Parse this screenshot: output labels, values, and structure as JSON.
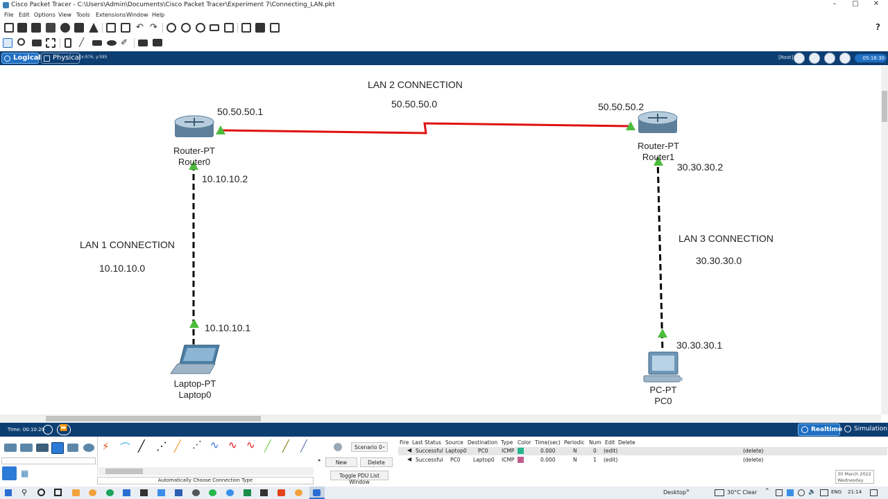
{
  "window": {
    "title": "Cisco Packet Tracer - C:\\Users\\Admin\\Documents\\Cisco Packet Tracer\\Experiment 7\\Connecting_LAN.pkt",
    "help": "?"
  },
  "menu": [
    "File",
    "Edit",
    "Options",
    "View",
    "Tools",
    "Extensions",
    "Window",
    "Help"
  ],
  "modebar": {
    "logical": "Logical",
    "physical": "Physical",
    "coords": "x:976, y:595",
    "root": "[Root]",
    "clock": "05:16:30"
  },
  "workspace": {
    "lan_labels": {
      "lan2_title": "LAN 2 CONNECTION",
      "lan2_net": "50.50.50.0",
      "lan1_title": "LAN 1 CONNECTION",
      "lan1_net": "10.10.10.0",
      "lan3_title": "LAN 3 CONNECTION",
      "lan3_net": "30.30.30.0"
    },
    "ip_labels": {
      "r0_serial": "50.50.50.1",
      "r1_serial": "50.50.50.2",
      "r0_fa": "10.10.10.2",
      "r1_fa": "30.30.30.2",
      "laptop": "10.10.10.1",
      "pc": "30.30.30.1"
    },
    "devices": {
      "router0": {
        "type": "Router-PT",
        "name": "Router0"
      },
      "router1": {
        "type": "Router-PT",
        "name": "Router1"
      },
      "laptop0": {
        "type": "Laptop-PT",
        "name": "Laptop0"
      },
      "pc0": {
        "type": "PC-PT",
        "name": "PC0"
      }
    },
    "colors": {
      "serial_link": "#e01010",
      "ethernet_link": "#000000",
      "link_up": "#4cbb3c"
    }
  },
  "timebar": {
    "time": "Time: 00:10:20",
    "realtime": "Realtime",
    "simulation": "Simulation"
  },
  "bottom": {
    "connection_hint": "Automatically Choose Connection Type",
    "scenario": "Scenario 0",
    "new": "New",
    "delete": "Delete",
    "toggle": "Toggle PDU List Window",
    "pdu_headers": [
      "Fire",
      "Last Status",
      "Source",
      "Destination",
      "Type",
      "Color",
      "Time(sec)",
      "Periodic",
      "Num",
      "Edit",
      "Delete"
    ],
    "pdu_rows": [
      {
        "status": "Successful",
        "source": "Laptop0",
        "destination": "PC0",
        "type": "ICMP",
        "color": "#28b48c",
        "time": "0.000",
        "periodic": "N",
        "num": "0",
        "edit": "(edit)",
        "delete": "(delete)"
      },
      {
        "status": "Successful",
        "source": "PC0",
        "destination": "Laptop0",
        "type": "ICMP",
        "color": "#c25d8e",
        "time": "0.000",
        "periodic": "N",
        "num": "1",
        "edit": "(edit)",
        "delete": "(delete)"
      }
    ],
    "tooltip_date": "30 March 2022",
    "tooltip_day": "Wednesday"
  },
  "taskbar": {
    "desktop": "Desktop",
    "weather": "30°C  Clear",
    "lang": "ENG",
    "clock": "21:14"
  }
}
